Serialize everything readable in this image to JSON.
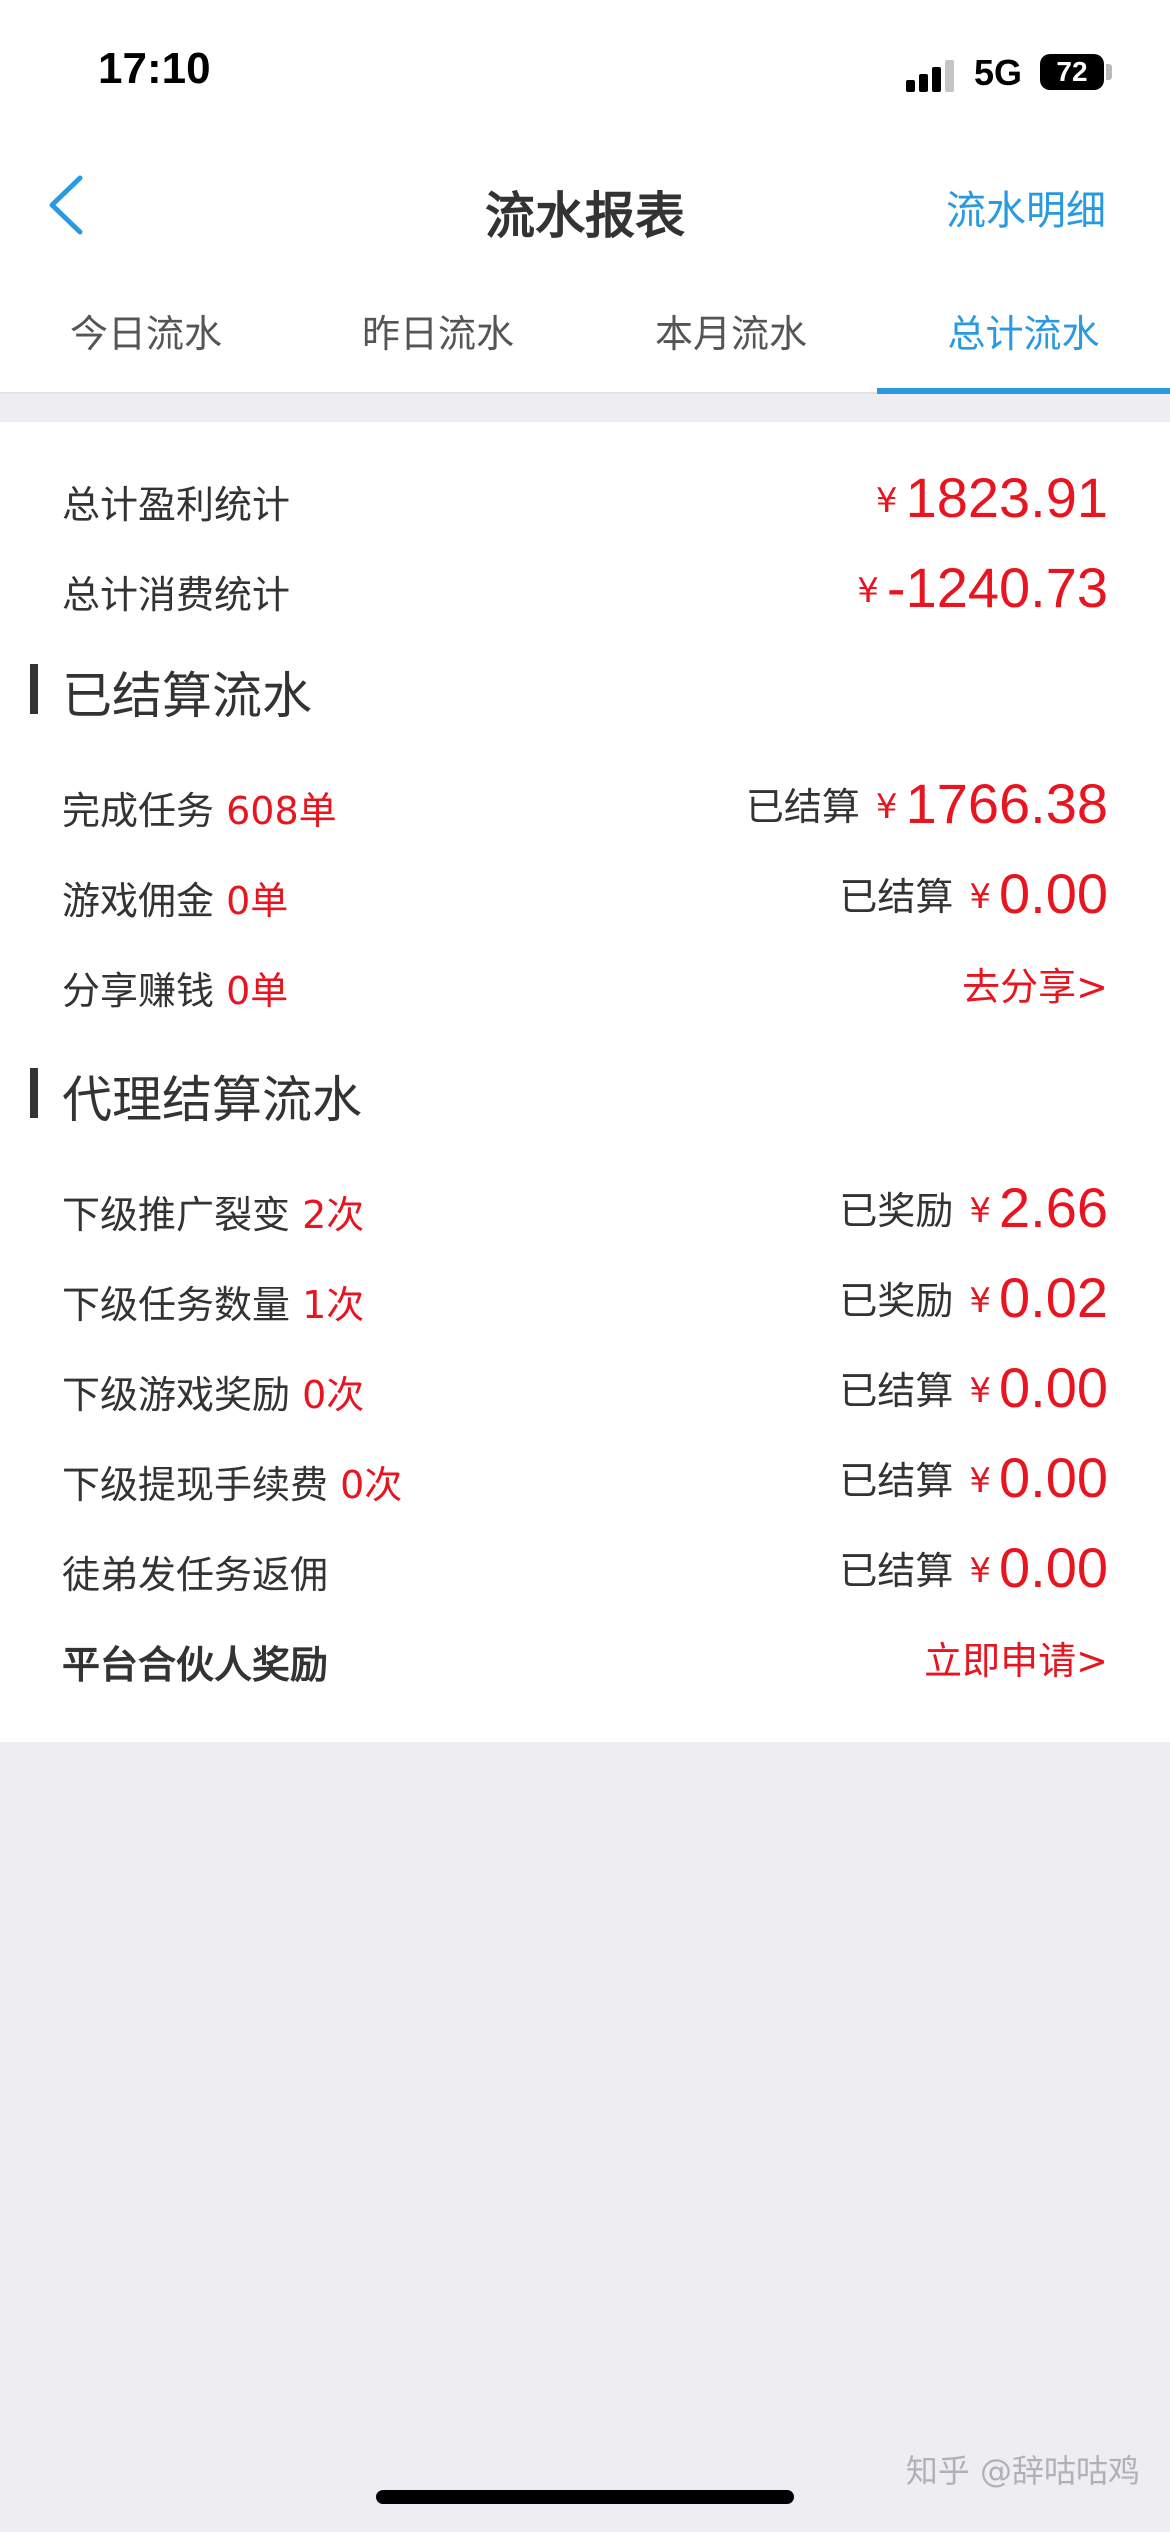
{
  "status_bar": {
    "time": "17:10",
    "network": "5G",
    "battery": "72"
  },
  "nav": {
    "back_icon": "chevron-left-icon",
    "title": "流水报表",
    "action_label": "流水明细"
  },
  "tabs": [
    {
      "label": "今日流水",
      "active": false
    },
    {
      "label": "昨日流水",
      "active": false
    },
    {
      "label": "本月流水",
      "active": false
    },
    {
      "label": "总计流水",
      "active": true
    }
  ],
  "summary": [
    {
      "label": "总计盈利统计",
      "currency": "¥",
      "amount": "1823.91"
    },
    {
      "label": "总计消费统计",
      "currency": "¥",
      "amount": "-1240.73"
    }
  ],
  "settled_section": {
    "title": "已结算流水",
    "rows": [
      {
        "label": "完成任务",
        "count": "608单",
        "status": "已结算",
        "currency": "¥",
        "amount": "1766.38"
      },
      {
        "label": "游戏佣金",
        "count": "0单",
        "status": "已结算",
        "currency": "¥",
        "amount": "0.00"
      },
      {
        "label": "分享赚钱",
        "count": "0单",
        "link": "去分享>"
      }
    ]
  },
  "agent_section": {
    "title": "代理结算流水",
    "rows": [
      {
        "label": "下级推广裂变",
        "count": "2次",
        "status": "已奖励",
        "currency": "¥",
        "amount": "2.66"
      },
      {
        "label": "下级任务数量",
        "count": "1次",
        "status": "已奖励",
        "currency": "¥",
        "amount": "0.02"
      },
      {
        "label": "下级游戏奖励",
        "count": "0次",
        "status": "已结算",
        "currency": "¥",
        "amount": "0.00"
      },
      {
        "label": "下级提现手续费",
        "count": "0次",
        "status": "已结算",
        "currency": "¥",
        "amount": "0.00"
      },
      {
        "label": "徒弟发任务返佣",
        "status": "已结算",
        "currency": "¥",
        "amount": "0.00"
      },
      {
        "label": "平台合伙人奖励",
        "link": "立即申请>"
      }
    ]
  },
  "watermark": "知乎 @辞咕咕鸡",
  "colors": {
    "accent": "#2a9ae0",
    "amount_red": "#e8141f",
    "background": "#eeeef2"
  }
}
